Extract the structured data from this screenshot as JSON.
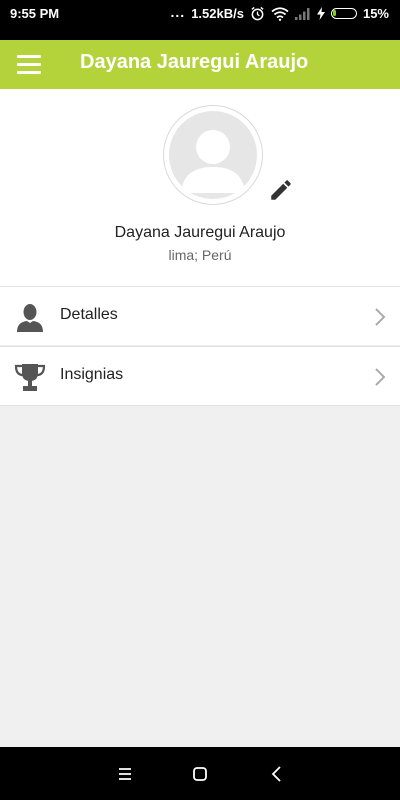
{
  "status_bar": {
    "time": "9:55 PM",
    "indicators": "...",
    "network_speed": "1.52kB/s",
    "battery_percent": "15%",
    "battery_level": 0.15,
    "icons": [
      "alarm-icon",
      "wifi-icon",
      "signal-icon",
      "charging-icon",
      "battery-icon"
    ]
  },
  "app_bar": {
    "menu_icon": "hamburger-menu-icon",
    "title": "Dayana Jauregui Araujo",
    "color": "#b4d33b"
  },
  "profile": {
    "avatar_icon": "default-avatar-icon",
    "edit_icon": "pencil-icon",
    "name": "Dayana Jauregui Araujo",
    "location": "lima; Perú"
  },
  "list": {
    "items": [
      {
        "label": "Detalles",
        "icon": "person-icon"
      },
      {
        "label": "Insignias",
        "icon": "trophy-icon"
      }
    ],
    "chevron_icon": "chevron-right-icon"
  },
  "nav_bar": {
    "icons": [
      "recent-apps-icon",
      "home-icon",
      "back-icon"
    ]
  }
}
